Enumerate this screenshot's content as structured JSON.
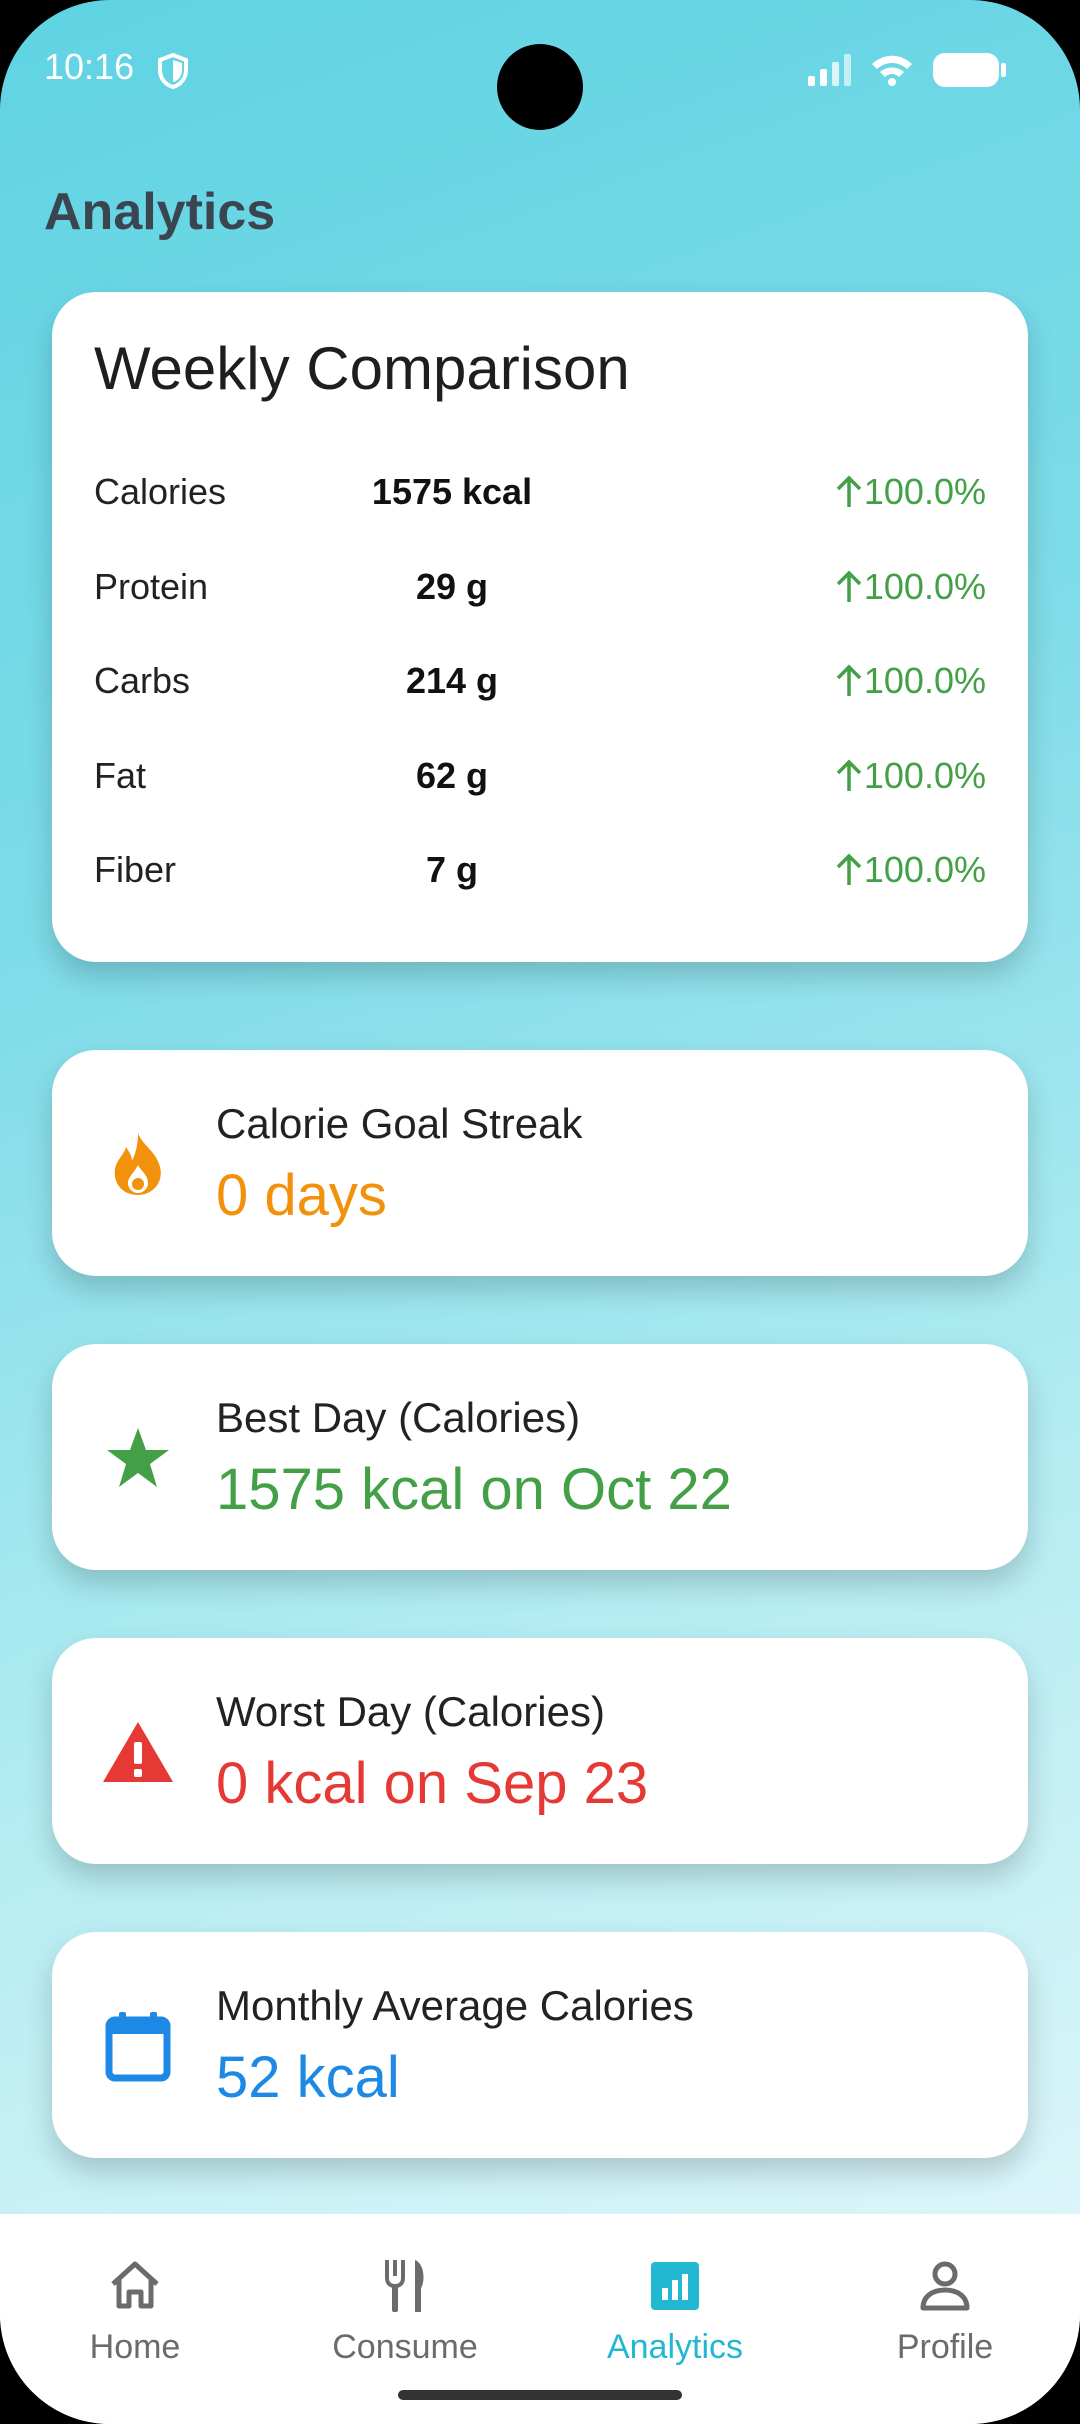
{
  "status": {
    "time": "10:16"
  },
  "page": {
    "title": "Analytics"
  },
  "weekly": {
    "title": "Weekly Comparison",
    "rows": [
      {
        "label": "Calories",
        "value": "1575 kcal",
        "change": "100.0%"
      },
      {
        "label": "Protein",
        "value": "29 g",
        "change": "100.0%"
      },
      {
        "label": "Carbs",
        "value": "214 g",
        "change": "100.0%"
      },
      {
        "label": "Fat",
        "value": "62 g",
        "change": "100.0%"
      },
      {
        "label": "Fiber",
        "value": "7 g",
        "change": "100.0%"
      }
    ]
  },
  "cards": {
    "streak": {
      "label": "Calorie Goal Streak",
      "value": "0 days",
      "icon": "fire-icon",
      "color": "#f2920c"
    },
    "best": {
      "label": "Best Day (Calories)",
      "value": "1575 kcal on Oct 22",
      "icon": "star-icon",
      "color": "#43a047"
    },
    "worst": {
      "label": "Worst Day (Calories)",
      "value": "0 kcal on Sep 23",
      "icon": "warning-icon",
      "color": "#e53935"
    },
    "monthly": {
      "label": "Monthly Average Calories",
      "value": "52 kcal",
      "icon": "calendar-icon",
      "color": "#1e88e5"
    }
  },
  "nav": {
    "items": [
      {
        "label": "Home",
        "icon": "home-icon"
      },
      {
        "label": "Consume",
        "icon": "utensils-icon"
      },
      {
        "label": "Analytics",
        "icon": "analytics-icon",
        "active": true
      },
      {
        "label": "Profile",
        "icon": "profile-icon"
      }
    ]
  }
}
